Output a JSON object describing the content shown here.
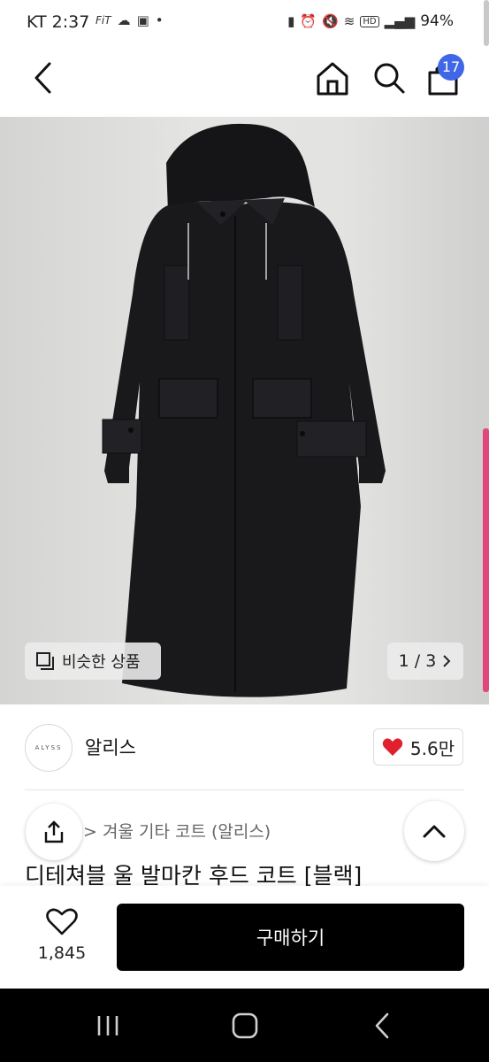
{
  "status_bar": {
    "time": "KT 2:37",
    "left_icons": [
      "FiT",
      "cloud-icon",
      "gallery-icon",
      "•"
    ],
    "right_icons": [
      "sim-icon",
      "alarm-icon",
      "mute-icon",
      "wifi-icon",
      "HD",
      "signal-icon"
    ],
    "battery": "94%"
  },
  "header": {
    "back_icon": "chevron-left-icon",
    "home_icon": "home-icon",
    "search_icon": "search-icon",
    "cart_icon": "shopping-bag-icon",
    "cart_count": "17"
  },
  "product_image": {
    "similar_label": "비슷한 상품",
    "counter": "1 / 3"
  },
  "brand": {
    "logo_text": "ALYSS",
    "name": "알리스",
    "likes": "5.6만"
  },
  "breadcrumb": "> 겨울 기타 코트 (알리스)",
  "title": "디테쳐블 울 발마칸 후드 코트 [블랙]",
  "buy_bar": {
    "wish_count": "1,845",
    "buy_label": "구매하기"
  },
  "colors": {
    "accent": "#3f67e8",
    "heart": "#e0202d",
    "buy_bg": "#000000",
    "scroll_edge": "#e1477a"
  }
}
